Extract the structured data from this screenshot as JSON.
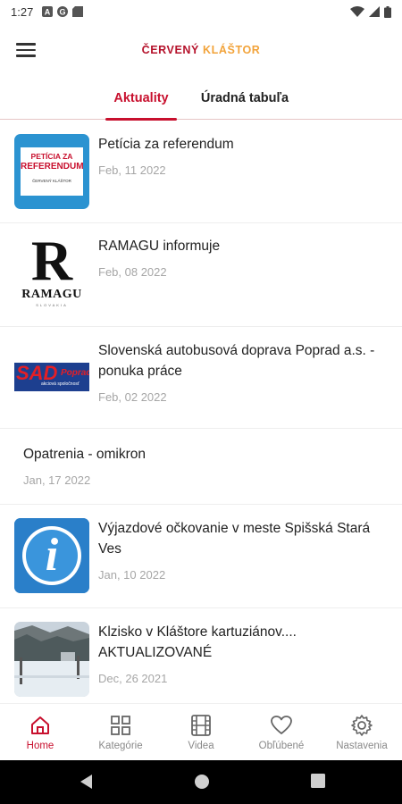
{
  "status_bar": {
    "time": "1:27"
  },
  "app": {
    "title_part1": "ČERVENÝ",
    "title_part2": "KLÁŠTOR",
    "brand_color": "#c8102e",
    "accent_color": "#f2a33a"
  },
  "tabs": [
    {
      "label": "Aktuality",
      "active": true
    },
    {
      "label": "Úradná tabuľa",
      "active": false
    }
  ],
  "news": [
    {
      "title": "Petícia za referendum",
      "date": "Feb, 11 2022",
      "thumb": "peticia-thumbnail",
      "thumb_line1": "PETÍCIA ZA",
      "thumb_line2": "REFERENDUM",
      "thumb_line3": "ČERVENÝ KLÁŠTOR"
    },
    {
      "title": "RAMAGU informuje",
      "date": "Feb, 08 2022",
      "thumb": "ramagu-logo-thumbnail",
      "thumb_letter": "R",
      "thumb_word": "RAMAGU",
      "thumb_sub": "SLOVAKIA"
    },
    {
      "title": "Slovenská autobusová doprava Poprad a.s. - ponuka práce",
      "date": "Feb, 02 2022",
      "thumb": "sad-poprad-logo-thumbnail",
      "thumb_big": "SAD",
      "thumb_small": "Poprad",
      "thumb_tag": "akciová spoločnosť"
    },
    {
      "title": "Opatrenia - omikron",
      "date": "Jan, 17 2022",
      "thumb": null
    },
    {
      "title": "Výjazdové očkovanie v meste Spišská Stará Ves",
      "date": "Jan, 10 2022",
      "thumb": "info-icon-thumbnail",
      "thumb_letter": "i"
    },
    {
      "title": "Klzisko v Kláštore kartuziánov.... AKTUALIZOVANÉ",
      "date": "Dec, 26 2021",
      "thumb": "ice-rink-photo-thumbnail"
    }
  ],
  "bottom_nav": [
    {
      "label": "Home",
      "icon": "home-icon",
      "active": true
    },
    {
      "label": "Kategórie",
      "icon": "grid-icon",
      "active": false
    },
    {
      "label": "Videa",
      "icon": "film-icon",
      "active": false
    },
    {
      "label": "Obľúbené",
      "icon": "heart-icon",
      "active": false
    },
    {
      "label": "Nastavenia",
      "icon": "gear-icon",
      "active": false
    }
  ]
}
